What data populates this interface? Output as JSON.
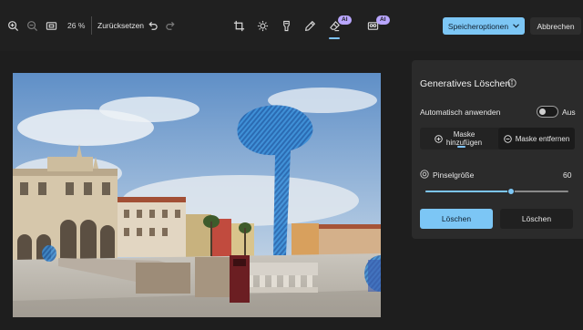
{
  "toolbar": {
    "zoom_in_icon": "zoom-in",
    "zoom_out_icon": "zoom-out",
    "fit_icon": "fit-to-window",
    "zoom_value": "26 %",
    "reset_label": "Zurücksetzen",
    "undo_icon": "undo",
    "redo_icon": "redo",
    "tools": [
      "crop",
      "adjust-brightness",
      "filter",
      "markup",
      "generative-erase",
      "background-blur"
    ],
    "ai_badge": "AI",
    "save_label": "Speicheroptionen",
    "cancel_label": "Abbrechen",
    "accent": "#7cc6f5"
  },
  "panel": {
    "title": "Generatives Löschen",
    "auto_apply_label": "Automatisch anwenden",
    "auto_apply_state": "Aus",
    "mask_add_line1": "Maske",
    "mask_add_line2": "hinzufügen",
    "mask_remove_label": "Maske entfernen",
    "brush_label": "Pinselgröße",
    "brush_value": "60",
    "brush_level_fraction": 0.6,
    "apply_label": "Löschen",
    "clear_label": "Löschen"
  }
}
